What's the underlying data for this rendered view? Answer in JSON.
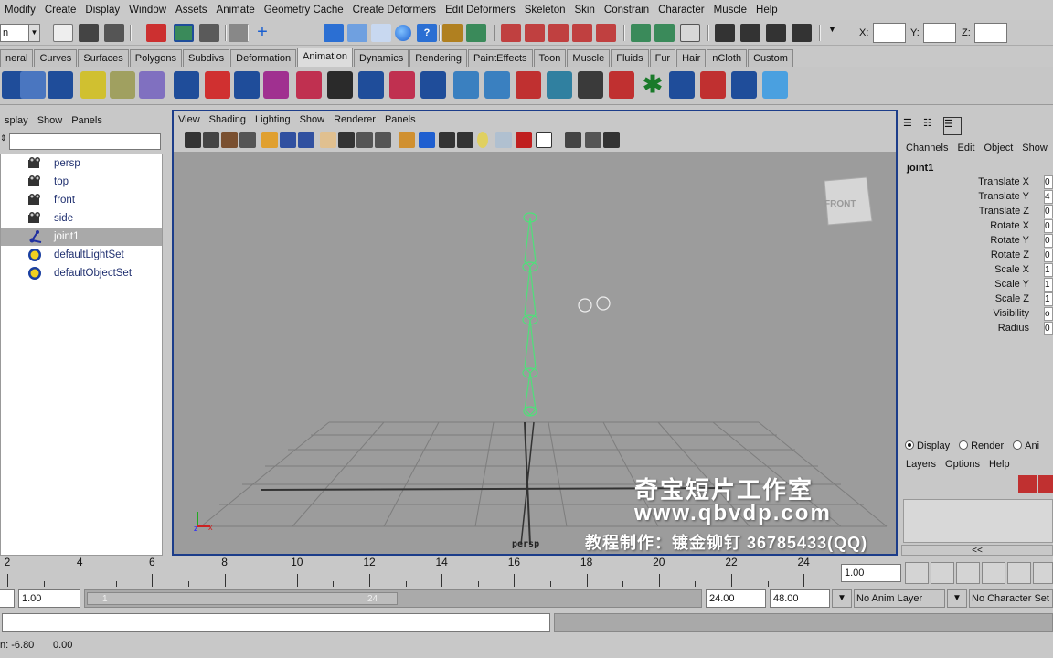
{
  "menubar": [
    "Modify",
    "Create",
    "Display",
    "Window",
    "Assets",
    "Animate",
    "Geometry Cache",
    "Create Deformers",
    "Edit Deformers",
    "Skeleton",
    "Skin",
    "Constrain",
    "Character",
    "Muscle",
    "Help"
  ],
  "statusline": {
    "mode": "n",
    "x_label": "X:",
    "y_label": "Y:",
    "z_label": "Z:"
  },
  "shelf_tabs": [
    "neral",
    "Curves",
    "Surfaces",
    "Polygons",
    "Subdivs",
    "Deformation",
    "Animation",
    "Dynamics",
    "Rendering",
    "PaintEffects",
    "Toon",
    "Muscle",
    "Fluids",
    "Fur",
    "Hair",
    "nCloth",
    "Custom"
  ],
  "shelf_active_tab": "Animation",
  "outliner": {
    "menu": [
      "splay",
      "Show",
      "Panels"
    ],
    "items": [
      {
        "label": "persp",
        "icon": "camera-icon",
        "selected": false
      },
      {
        "label": "top",
        "icon": "camera-icon",
        "selected": false
      },
      {
        "label": "front",
        "icon": "camera-icon",
        "selected": false
      },
      {
        "label": "side",
        "icon": "camera-icon",
        "selected": false
      },
      {
        "label": "joint1",
        "icon": "joint-icon",
        "selected": true
      },
      {
        "label": "defaultLightSet",
        "icon": "set-icon",
        "selected": false
      },
      {
        "label": "defaultObjectSet",
        "icon": "set-icon",
        "selected": false
      }
    ]
  },
  "viewport": {
    "menu": [
      "View",
      "Shading",
      "Lighting",
      "Show",
      "Renderer",
      "Panels"
    ],
    "camera_label": "persp",
    "viewcube_label": "FRONT",
    "watermark": {
      "line1": "奇宝短片工作室",
      "line2": "www.qbvdp.com",
      "line3": "教程制作：镀金铆钉  36785433(QQ)"
    }
  },
  "channelbox": {
    "menu": [
      "Channels",
      "Edit",
      "Object",
      "Show"
    ],
    "object": "joint1",
    "attributes": [
      {
        "name": "Translate X",
        "value": "0"
      },
      {
        "name": "Translate Y",
        "value": "4"
      },
      {
        "name": "Translate Z",
        "value": "0"
      },
      {
        "name": "Rotate X",
        "value": "0"
      },
      {
        "name": "Rotate Y",
        "value": "0"
      },
      {
        "name": "Rotate Z",
        "value": "0"
      },
      {
        "name": "Scale X",
        "value": "1"
      },
      {
        "name": "Scale Y",
        "value": "1"
      },
      {
        "name": "Scale Z",
        "value": "1"
      },
      {
        "name": "Visibility",
        "value": "o"
      },
      {
        "name": "Radius",
        "value": "0"
      }
    ]
  },
  "layers": {
    "radios": [
      {
        "label": "Display",
        "on": true
      },
      {
        "label": "Render",
        "on": false
      },
      {
        "label": "Ani",
        "on": false
      }
    ],
    "menu": [
      "Layers",
      "Options",
      "Help"
    ],
    "collapse": "<<"
  },
  "timeline": {
    "ticks": [
      "2",
      "4",
      "6",
      "8",
      "10",
      "12",
      "14",
      "16",
      "18",
      "20",
      "22",
      "24"
    ],
    "current_frame": "1.00"
  },
  "range": {
    "start": "1.00",
    "slider_start": "1",
    "slider_end": "24",
    "end": "24.00",
    "anim_end": "48.00",
    "anim_layer": "No Anim Layer",
    "character_set": "No Character Set"
  },
  "help": {
    "prefix": "n: -6.80",
    "value": "0.00"
  }
}
